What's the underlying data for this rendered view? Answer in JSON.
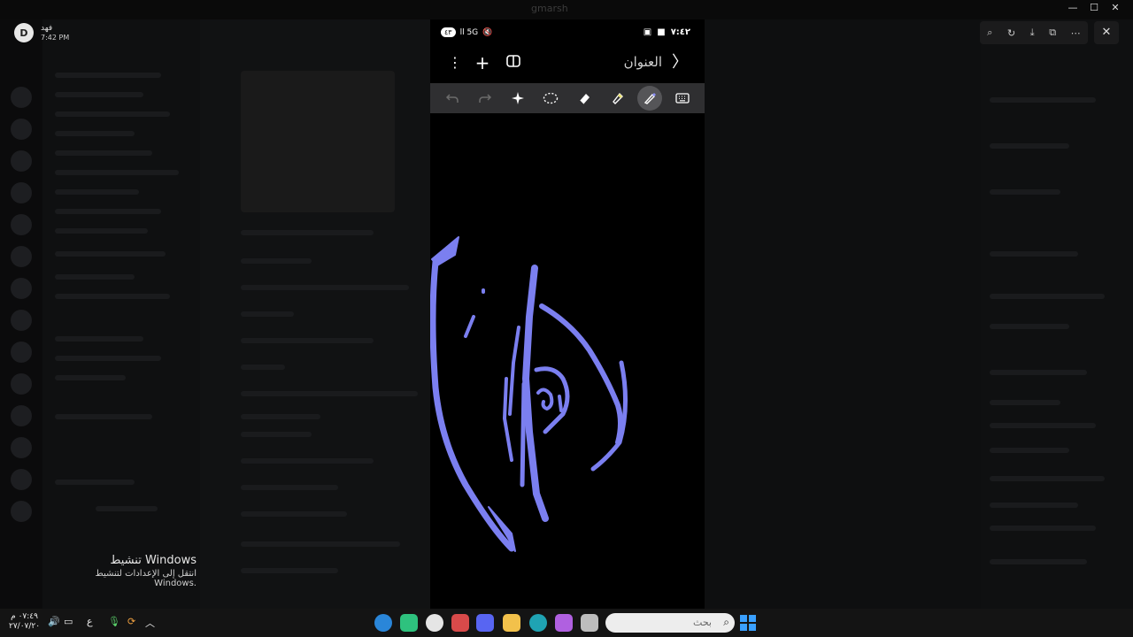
{
  "window": {
    "caption": "gmarsh"
  },
  "user": {
    "initial": "D",
    "name": "فهد",
    "time": "7:42 PM"
  },
  "phone": {
    "status": {
      "left_pill": "٤٣",
      "left_icons": "ll 5G",
      "right_time": "٧:٤٢"
    },
    "appbar": {
      "title": "العنوان"
    },
    "tools": [
      "undo-icon",
      "redo-icon",
      "sparkle-icon",
      "lasso-icon",
      "eraser-icon",
      "highlighter-icon",
      "pen-icon",
      "keyboard-icon"
    ],
    "stroke_color": "#7b7ff0"
  },
  "activate": {
    "title": "تنشيط Windows",
    "subtitle": "انتقل إلى الإعدادات لتنشيط Windows."
  },
  "taskbar": {
    "search_placeholder": "بحث",
    "clock_time": "٠٧:٤٩ م",
    "clock_date": "٢٧/٠٧/٢٠",
    "lang": "ع"
  }
}
